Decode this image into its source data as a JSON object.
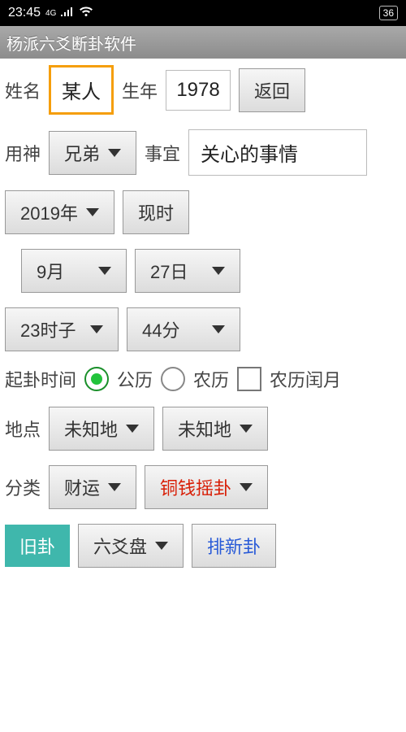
{
  "status": {
    "time": "23:45",
    "network": "4G",
    "battery": "36"
  },
  "app": {
    "title": "杨派六爻断卦软件"
  },
  "labels": {
    "name": "姓名",
    "birthYear": "生年",
    "back": "返回",
    "yongshen": "用神",
    "shiyi": "事宜",
    "now": "现时",
    "qiguaTime": "起卦时间",
    "solar": "公历",
    "lunar": "农历",
    "lunarLeap": "农历闰月",
    "place": "地点",
    "category": "分类"
  },
  "fields": {
    "name": "某人",
    "birthYear": "1978",
    "yongshen": "兄弟",
    "shiyi": "关心的事情",
    "year": "2019年",
    "month": "9月",
    "day": "27日",
    "hour": "23时子",
    "minute": "44分",
    "place1": "未知地",
    "place2": "未知地",
    "category": "财运",
    "method": "铜钱摇卦",
    "old": "旧卦",
    "liuyao": "六爻盘",
    "paixin": "排新卦"
  }
}
